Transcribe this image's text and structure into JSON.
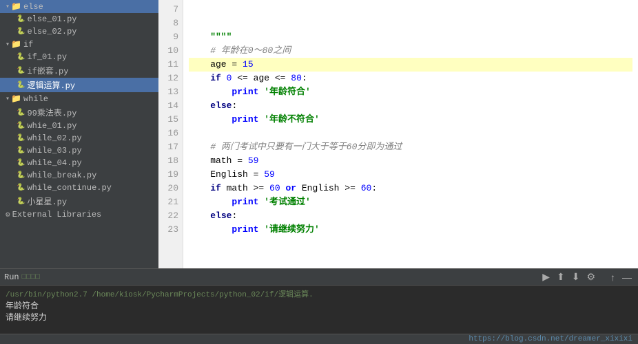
{
  "sidebar": {
    "items": [
      {
        "id": "folder-else",
        "label": "else",
        "type": "folder",
        "expanded": true,
        "indent": 0
      },
      {
        "id": "file-else01",
        "label": "else_01.py",
        "type": "file",
        "indent": 1
      },
      {
        "id": "file-else02",
        "label": "else_02.py",
        "type": "file",
        "indent": 1
      },
      {
        "id": "folder-if",
        "label": "if",
        "type": "folder",
        "expanded": true,
        "indent": 0
      },
      {
        "id": "file-if01",
        "label": "if_01.py",
        "type": "file",
        "indent": 1
      },
      {
        "id": "file-ifnested",
        "label": "if嵌套.py",
        "type": "file",
        "indent": 1
      },
      {
        "id": "file-logic",
        "label": "逻辑运算.py",
        "type": "file",
        "indent": 1,
        "selected": true
      },
      {
        "id": "folder-while",
        "label": "while",
        "type": "folder",
        "expanded": true,
        "indent": 0
      },
      {
        "id": "file-99",
        "label": "99乘法表.py",
        "type": "file",
        "indent": 1
      },
      {
        "id": "file-whie01",
        "label": "whie_01.py",
        "type": "file",
        "indent": 1
      },
      {
        "id": "file-while02",
        "label": "while_02.py",
        "type": "file",
        "indent": 1
      },
      {
        "id": "file-while03",
        "label": "while_03.py",
        "type": "file",
        "indent": 1
      },
      {
        "id": "file-while04",
        "label": "while_04.py",
        "type": "file",
        "indent": 1
      },
      {
        "id": "file-whilebreak",
        "label": "while_break.py",
        "type": "file",
        "indent": 1
      },
      {
        "id": "file-whilecontinue",
        "label": "while_continue.py",
        "type": "file",
        "indent": 1
      },
      {
        "id": "file-stars",
        "label": "小星星.py",
        "type": "file",
        "indent": 1
      },
      {
        "id": "ext-libraries",
        "label": "External Libraries",
        "type": "special",
        "indent": 0
      }
    ]
  },
  "editor": {
    "lines": [
      {
        "num": 7,
        "content": ""
      },
      {
        "num": 8,
        "content": ""
      },
      {
        "num": 9,
        "content": "    \"\"\"\""
      },
      {
        "num": 10,
        "content": "    # 年龄在0～80之间",
        "isComment": true
      },
      {
        "num": 11,
        "content": "    age = 15",
        "highlighted": true
      },
      {
        "num": 12,
        "content": "    if 0 <= age <= 80:"
      },
      {
        "num": 13,
        "content": "        print '年龄符合'"
      },
      {
        "num": 14,
        "content": "    else:"
      },
      {
        "num": 15,
        "content": "        print '年龄不符合'"
      },
      {
        "num": 16,
        "content": ""
      },
      {
        "num": 17,
        "content": "    # 两门考试中只要有一门大于等于60分即为通过",
        "isComment": true
      },
      {
        "num": 18,
        "content": "    math = 59"
      },
      {
        "num": 19,
        "content": "    English = 59"
      },
      {
        "num": 20,
        "content": "    if math >= 60 or English >= 60:"
      },
      {
        "num": 21,
        "content": "        print '考试通过'"
      },
      {
        "num": 22,
        "content": "    else:"
      },
      {
        "num": 23,
        "content": "        print '请继续努力'"
      }
    ]
  },
  "run_panel": {
    "label": "Run",
    "icon_label": "□□□□",
    "command": "/usr/bin/python2.7 /home/kiosk/PycharmProjects/python_02/if/逻辑运算.",
    "output_lines": [
      "年龄符合",
      "请继续努力"
    ],
    "bottom_link": "https://blog.csdn.net/dreamer_xixixi"
  }
}
